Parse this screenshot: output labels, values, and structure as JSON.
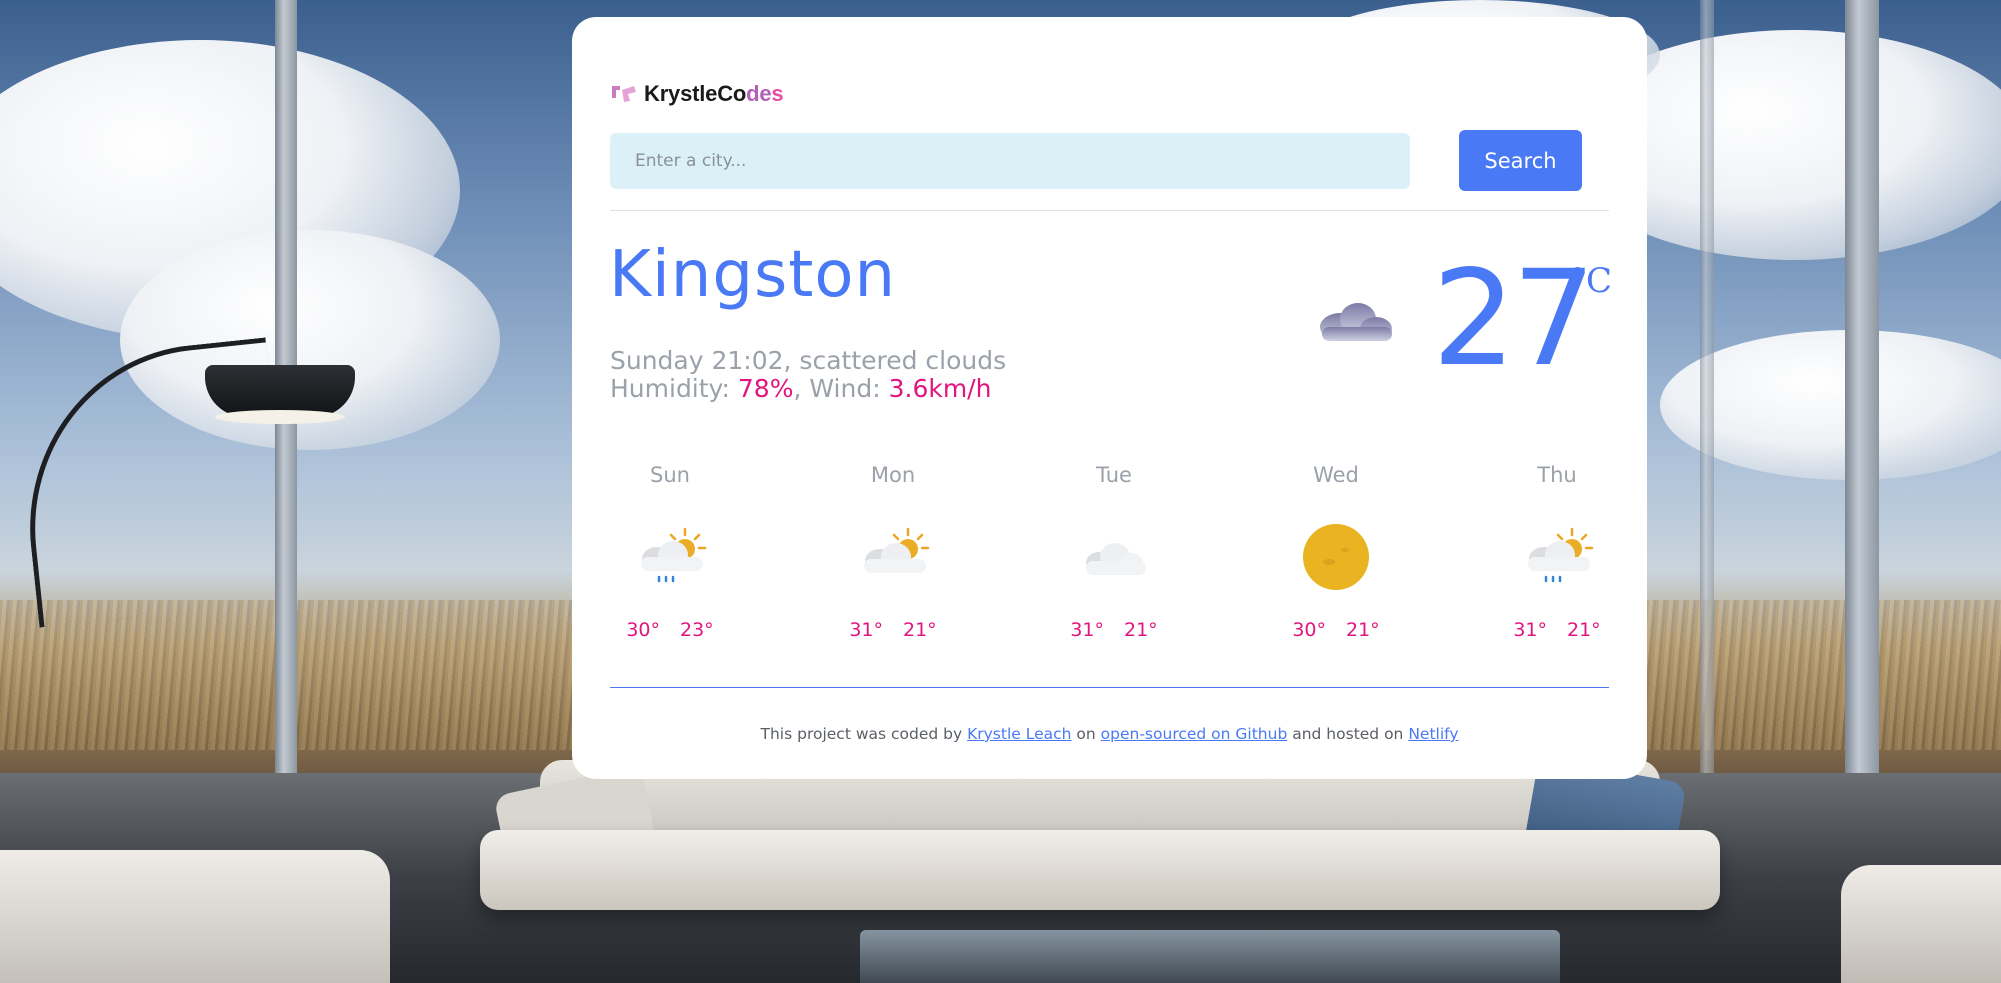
{
  "brand": {
    "name_main": "KrystleCo",
    "name_accent1": "d",
    "name_accent2": "e",
    "name_accent3": "s"
  },
  "search": {
    "placeholder": "Enter a city...",
    "value": "",
    "button_label": "Search"
  },
  "current": {
    "city": "Kingston",
    "datetime_desc": "Sunday 21:02, scattered clouds",
    "humidity_label": "Humidity: ",
    "humidity_value": "78%",
    "separator": ", ",
    "wind_label": "Wind: ",
    "wind_value": "3.6km/h",
    "temperature": "27",
    "unit": "°C",
    "icon": "scattered-clouds-icon"
  },
  "forecast": [
    {
      "day": "Sun",
      "max": "30°",
      "min": "23°",
      "icon": "sun-rain-cloud-icon"
    },
    {
      "day": "Mon",
      "max": "31°",
      "min": "21°",
      "icon": "sun-cloud-icon"
    },
    {
      "day": "Tue",
      "max": "31°",
      "min": "21°",
      "icon": "cloud-icon"
    },
    {
      "day": "Wed",
      "max": "30°",
      "min": "21°",
      "icon": "sun-icon"
    },
    {
      "day": "Thu",
      "max": "31°",
      "min": "21°",
      "icon": "sun-rain-cloud-icon"
    }
  ],
  "footer": {
    "text1": "This project was coded by ",
    "link1": "Krystle Leach",
    "text2": " on ",
    "link2": "open-sourced on Github",
    "text3": " and hosted on ",
    "link3": "Netlify"
  },
  "colors": {
    "accent_blue": "#4a79f5",
    "accent_pink": "#e1157f",
    "input_bg": "#dcf1f7",
    "muted_text": "#9ba1a9"
  }
}
